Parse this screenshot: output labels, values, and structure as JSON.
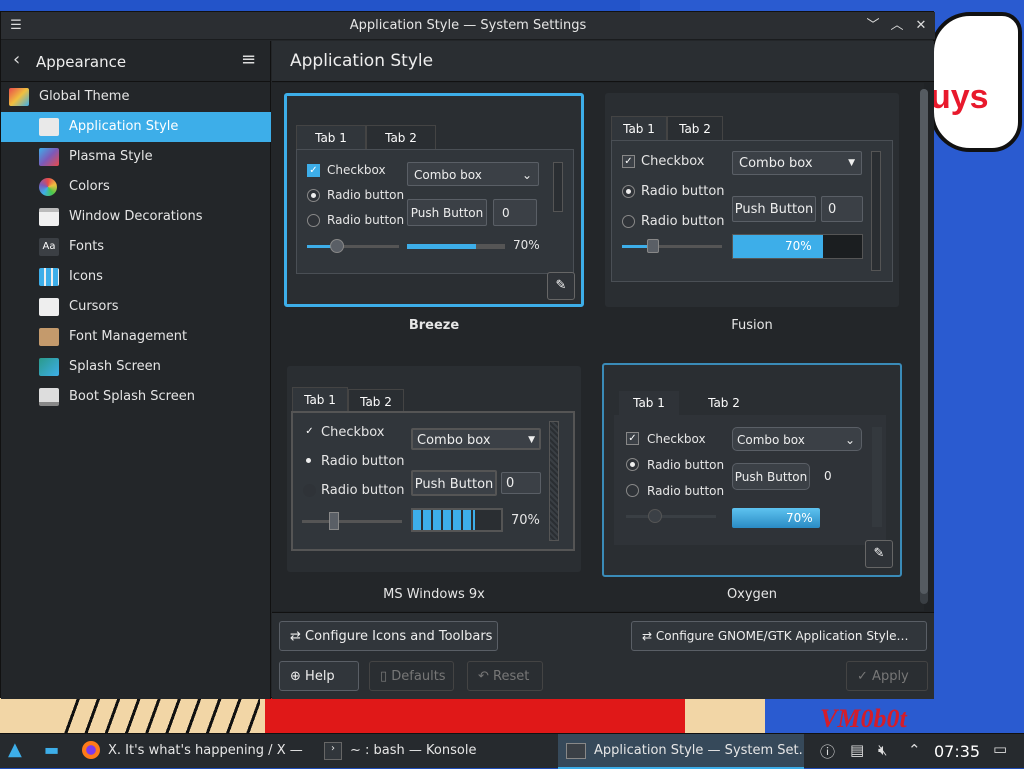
{
  "window": {
    "title": "Application Style — System Settings",
    "buttons": {
      "min": "﹀",
      "max": "︿",
      "close": "✕"
    }
  },
  "sidebar": {
    "back_label": "Appearance",
    "top_item": {
      "label": "Global Theme",
      "icon": "global-theme-icon"
    },
    "items": [
      {
        "label": "Application Style",
        "icon": "application-style-icon",
        "color": "#e9e9e9"
      },
      {
        "label": "Plasma Style",
        "icon": "plasma-style-icon",
        "color": "#7c5ab9"
      },
      {
        "label": "Colors",
        "icon": "colors-icon",
        "color": "#e84a8f"
      },
      {
        "label": "Window Decorations",
        "icon": "window-decorations-icon",
        "color": "#f0f0f0"
      },
      {
        "label": "Fonts",
        "icon": "fonts-icon",
        "color": "#444"
      },
      {
        "label": "Icons",
        "icon": "icons-icon",
        "color": "#3daee9"
      },
      {
        "label": "Cursors",
        "icon": "cursors-icon",
        "color": "#888"
      },
      {
        "label": "Font Management",
        "icon": "font-management-icon",
        "color": "#c49a6c"
      },
      {
        "label": "Splash Screen",
        "icon": "splash-screen-icon",
        "color": "#2a9a8a"
      },
      {
        "label": "Boot Splash Screen",
        "icon": "boot-splash-screen-icon",
        "color": "#ddd"
      }
    ]
  },
  "main": {
    "title": "Application Style",
    "styles": [
      {
        "name": "Breeze",
        "selected": true
      },
      {
        "name": "Fusion",
        "selected": false
      },
      {
        "name": "MS Windows 9x",
        "selected": false
      },
      {
        "name": "Oxygen",
        "selected": false
      }
    ],
    "preview": {
      "tab1": "Tab 1",
      "tab2": "Tab 2",
      "checkbox": "Checkbox",
      "radio": "Radio button",
      "combo": "Combo box",
      "push": "Push Button",
      "spin": "0",
      "progress_label": "70%",
      "progress": 0.7
    },
    "buttons": {
      "configure_icons": "Configure Icons and Toolbars",
      "configure_gtk": "Configure GNOME/GTK Application Style…",
      "help": "Help",
      "defaults": "Defaults",
      "reset": "Reset",
      "apply": "Apply"
    }
  },
  "taskbar": {
    "tasks": [
      {
        "label": "X. It's what's happening / X — ..."
      },
      {
        "label": "~ : bash — Konsole"
      },
      {
        "label": "Application Style  — System Set..."
      }
    ],
    "clock": "07:35"
  },
  "desktop": {
    "bubble": "uys",
    "watermark": "VM0b0t"
  }
}
